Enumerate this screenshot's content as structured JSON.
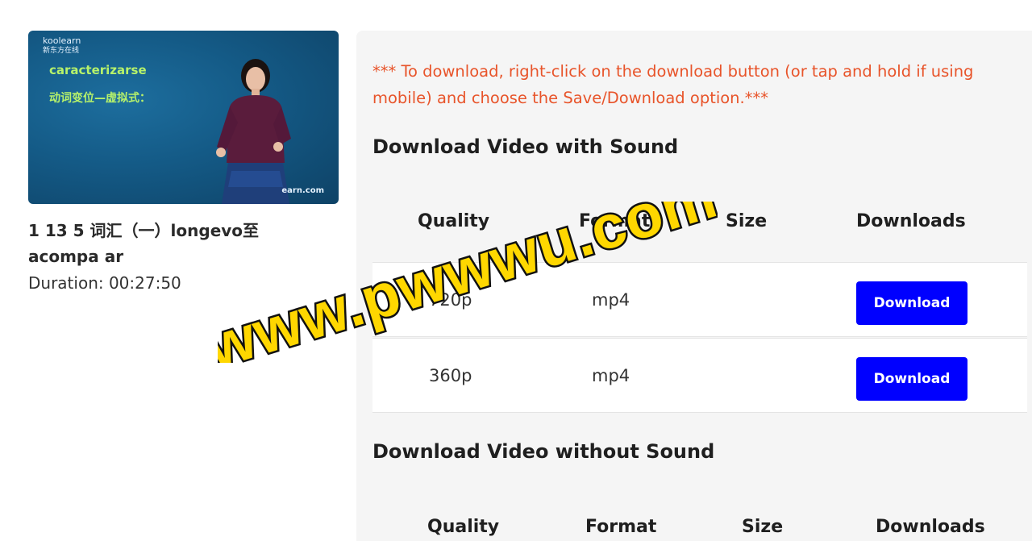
{
  "thumbnail": {
    "logo": "koolearn",
    "logo_cn": "新东方在线",
    "word": "caracterizarse",
    "subtitle": "动词变位—虚拟式：",
    "site": "earn.com"
  },
  "video": {
    "title": "1 13 5 词汇（一）longevo至 acompa ar",
    "duration": "Duration: 00:27:50"
  },
  "notice": "*** To download, right-click on the download button (or tap and hold if using mobile) and choose the Save/Download option.***",
  "with_sound": {
    "title": "Download Video with Sound",
    "headers": {
      "quality": "Quality",
      "format": "Format",
      "size": "Size",
      "downloads": "Downloads"
    },
    "rows": [
      {
        "quality": "720p",
        "format": "mp4",
        "size": "",
        "button": "Download"
      },
      {
        "quality": "360p",
        "format": "mp4",
        "size": "",
        "button": "Download"
      }
    ]
  },
  "without_sound": {
    "title": "Download Video without Sound",
    "headers": {
      "quality": "Quality",
      "format": "Format",
      "size": "Size",
      "downloads": "Downloads"
    }
  },
  "watermark": "www.pwwwu.com",
  "colors": {
    "notice": "#e8542a",
    "button": "#0000ff",
    "panel": "#f5f5f5",
    "watermark_fill": "#ffd700"
  }
}
